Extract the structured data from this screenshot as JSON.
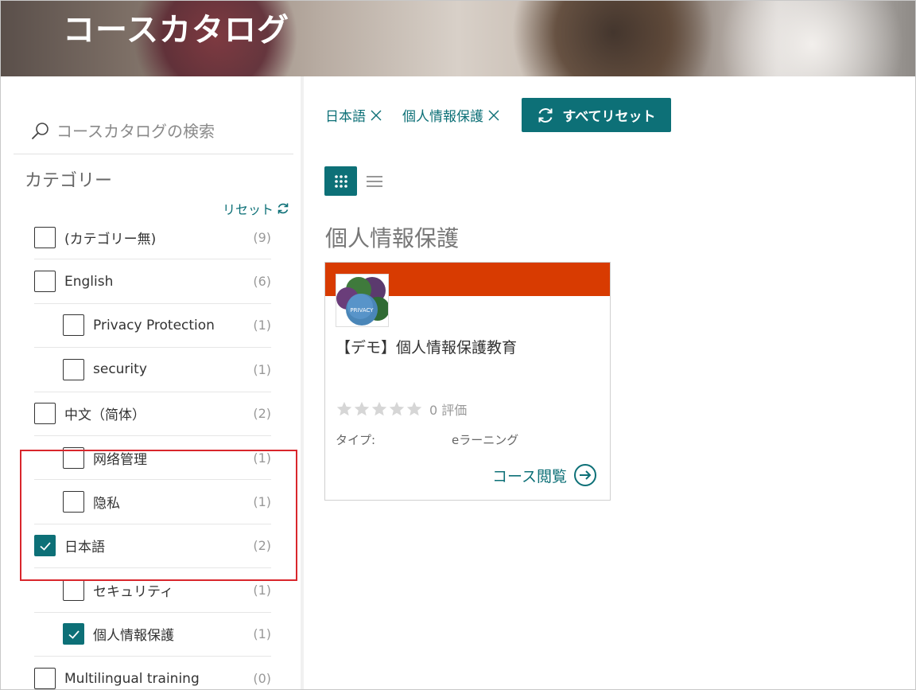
{
  "hero": {
    "title": "コースカタログ"
  },
  "sidebar": {
    "search": {
      "placeholder": "コースカタログの検索",
      "value": ""
    },
    "category_title": "カテゴリー",
    "reset_label": "リセット",
    "categories": [
      {
        "label": "(カテゴリー無)",
        "count": "(9)",
        "checked": false,
        "indent": false
      },
      {
        "label": "English",
        "count": "(6)",
        "checked": false,
        "indent": false
      },
      {
        "label": "Privacy Protection",
        "count": "(1)",
        "checked": false,
        "indent": true
      },
      {
        "label": "security",
        "count": "(1)",
        "checked": false,
        "indent": true
      },
      {
        "label": "中文（简体）",
        "count": "(2)",
        "checked": false,
        "indent": false
      },
      {
        "label": "网络管理",
        "count": "(1)",
        "checked": false,
        "indent": true
      },
      {
        "label": "隐私",
        "count": "(1)",
        "checked": false,
        "indent": true
      },
      {
        "label": "日本語",
        "count": "(2)",
        "checked": true,
        "indent": false
      },
      {
        "label": "セキュリティ",
        "count": "(1)",
        "checked": false,
        "indent": true
      },
      {
        "label": "個人情報保護",
        "count": "(1)",
        "checked": true,
        "indent": true
      },
      {
        "label": "Multilingual training",
        "count": "(0)",
        "checked": false,
        "indent": false
      }
    ]
  },
  "filters": {
    "chips": [
      {
        "label": "日本語"
      },
      {
        "label": "個人情報保護"
      }
    ],
    "reset_all_label": "すべてリセット"
  },
  "section": {
    "title": "個人情報保護"
  },
  "course": {
    "title": "【デモ】個人情報保護教育",
    "rating_count": "0 評価",
    "rating_value": 0,
    "type_label": "タイプ:",
    "type_value": "eラーニング",
    "link_label": "コース閲覧",
    "band_color": "#d83b01",
    "thumbnail_text": "PRIVACY"
  },
  "colors": {
    "accent": "#0d7077",
    "highlight": "#d9262c"
  }
}
